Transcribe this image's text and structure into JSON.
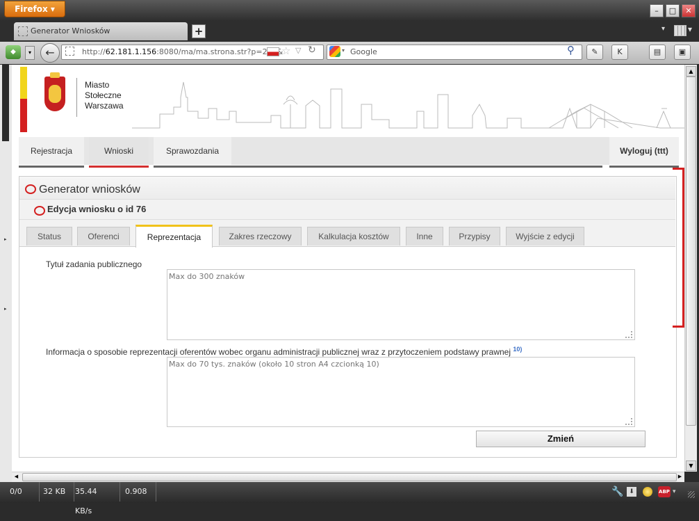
{
  "browser": {
    "app_button": "Firefox",
    "tab_title": "Generator Wniosków",
    "url_prefix": "http://",
    "url_host": "62.181.1.156",
    "url_rest": ":8080/ma/ma.strona.str?p=213&",
    "search_placeholder": "Google",
    "status": {
      "pos": "0/0",
      "size": "32 KB",
      "speed": "35.44 KB/s",
      "time": "0.908"
    },
    "addon_abp": "ABP"
  },
  "header": {
    "city_name": [
      "Miasto",
      "Stołeczne",
      "Warszawa"
    ]
  },
  "menu": {
    "items": [
      "Rejestracja",
      "Wnioski",
      "Sprawozdania"
    ],
    "active": "Wnioski",
    "logout": "Wyloguj (ttt)"
  },
  "panel": {
    "title": "Generator wniosków",
    "subtitle": "Edycja wniosku o id 76",
    "tabs": [
      "Status",
      "Oferenci",
      "Reprezentacja",
      "Zakres rzeczowy",
      "Kalkulacja kosztów",
      "Inne",
      "Przypisy",
      "Wyjście z edycji"
    ],
    "active_tab": "Reprezentacja"
  },
  "form": {
    "field1_label": "Tytuł zadania publicznego",
    "field1_placeholder": "Max do 300 znaków",
    "field2_label": "Informacja o sposobie reprezentacji oferentów wobec organu administracji publicznej wraz z przytoczeniem podstawy prawnej",
    "field2_footnote": "10)",
    "field2_placeholder": "Max do 70 tys. znaków (około 10 stron A4 czcionką 10)",
    "submit_label": "Zmień"
  },
  "colors": {
    "accent_red": "#d42020",
    "accent_yellow": "#f1d51c",
    "firefox_orange": "#e8851f"
  }
}
